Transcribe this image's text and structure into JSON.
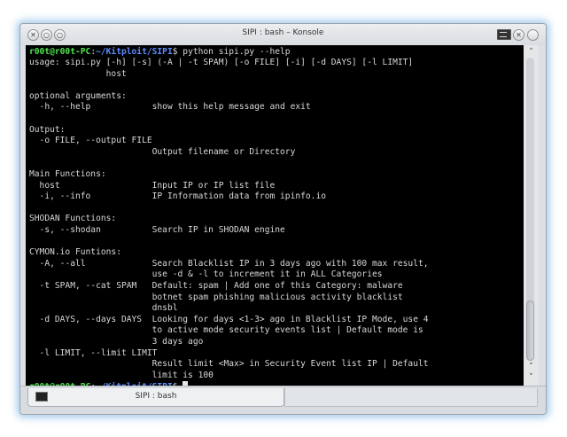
{
  "window": {
    "title": "SIPI : bash – Konsole",
    "controls": {
      "close": "✕",
      "minimize": "○",
      "maximize": "○",
      "keep_above": "✕"
    }
  },
  "terminal": {
    "prompt": {
      "user_host": "r00t@r00t-PC",
      "sep": ":",
      "path": "~/Kitploit/SIPI",
      "symbol": "$"
    },
    "command": " python sipi.py --help",
    "output_lines": [
      "usage: sipi.py [-h] [-s] (-A | -t SPAM) [-o FILE] [-i] [-d DAYS] [-l LIMIT]",
      "               host",
      "",
      "optional arguments:",
      "  -h, --help            show this help message and exit",
      "",
      "Output:",
      "  -o FILE, --output FILE",
      "                        Output filename or Directory",
      "",
      "Main Functions:",
      "  host                  Input IP or IP list file",
      "  -i, --info            IP Information data from ipinfo.io",
      "",
      "SHODAN Functions:",
      "  -s, --shodan          Search IP in SHODAN engine",
      "",
      "CYMON.io Funtions:",
      "  -A, --all             Search Blacklist IP in 3 days ago with 100 max result,",
      "                        use -d & -l to increment it in ALL Categories",
      "  -t SPAM, --cat SPAM   Default: spam | Add one of this Category: malware",
      "                        botnet spam phishing malicious activity blacklist",
      "                        dnsbl",
      "  -d DAYS, --days DAYS  Looking for days <1-3> ago in Blacklist IP Mode, use 4",
      "                        to active mode security events list | Default mode is",
      "                        3 days ago",
      "  -l LIMIT, --limit LIMIT",
      "                        Result limit <Max> in Security Event list IP | Default",
      "                        limit is 100"
    ]
  },
  "scrollbar": {
    "up_arrow": "˄",
    "down_arrow": "˅",
    "position_fraction": 1.0
  },
  "tabs": [
    {
      "label": "SIPI : bash"
    }
  ],
  "colors": {
    "user_host": "#4ee54e",
    "path": "#5c8cff",
    "text": "#d8d8d8",
    "background": "#000000"
  }
}
